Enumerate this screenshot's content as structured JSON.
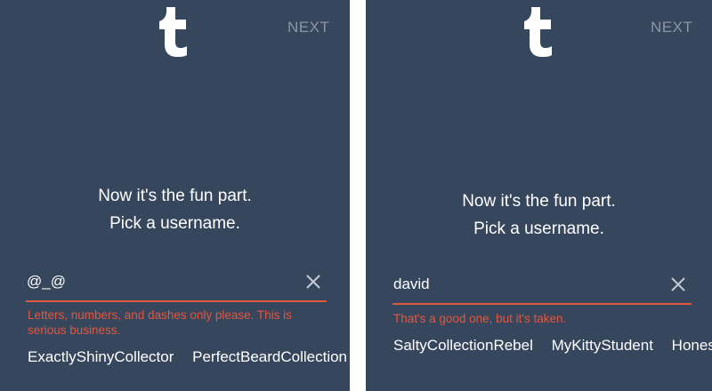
{
  "screens": [
    {
      "logo_icon": "tumblr-t-icon",
      "next_label": "NEXT",
      "headline_line1": "Now it's the fun part.",
      "headline_line2": "Pick a username.",
      "username_value": "@_@",
      "clear_icon": "close-icon",
      "error_text": "Letters, numbers, and dashes only please. This is serious business.",
      "suggestions": [
        "ExactlyShinyCollector",
        "PerfectBeardCollection"
      ]
    },
    {
      "logo_icon": "tumblr-t-icon",
      "next_label": "NEXT",
      "headline_line1": "Now it's the fun part.",
      "headline_line2": "Pick a username.",
      "username_value": "david",
      "clear_icon": "close-icon",
      "error_text": "That's a good one, but it's taken.",
      "suggestions": [
        "SaltyCollectionRebel",
        "MyKittyStudent",
        "Hones"
      ]
    }
  ],
  "colors": {
    "background": "#36465d",
    "accent_error": "#e2573f",
    "next_muted": "#8c96a5",
    "text": "#ffffff"
  }
}
